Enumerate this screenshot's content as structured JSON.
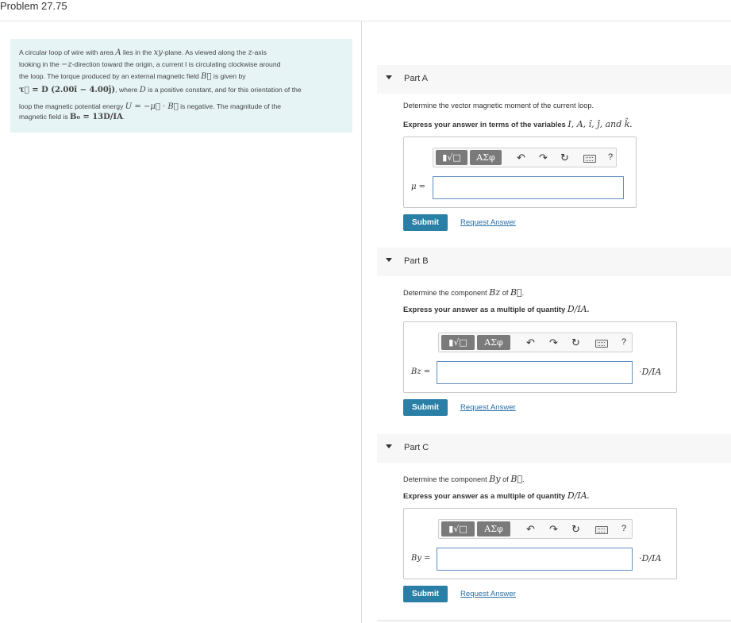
{
  "page": {
    "title": "Problem 27.75"
  },
  "problem": {
    "line1a": "A circular loop of wire with area ",
    "A": "A",
    "line1b": " lies in the ",
    "xy": "xy",
    "line1c": "-plane. As viewed along the ",
    "z": "z",
    "line1d": "-axis",
    "line2a": "looking in the ",
    "negz": "−z",
    "line2b": "-direction toward the origin, a current I is circulating clockwise around",
    "line3a": "the loop. The torque produced by an external magnetic field ",
    "B": "B⃗",
    "line3b": " is given by",
    "torque_expr": "τ⃗ = D (2.00î − 4.00ĵ)",
    "line4b": ", where ",
    "D": "D",
    "line4c": " is a positive constant, and for this orientation of the",
    "line5a": "loop the magnetic potential energy ",
    "U_expr": "U = −μ⃗ · B⃗",
    "line5b": " is negative. The magnitude of the",
    "line6a": "magnetic field is ",
    "B0_expr": "B₀ = 13D/IA",
    "line6b": "."
  },
  "toolbar": {
    "templates_label": "▮√□",
    "greek_label": "ΑΣφ",
    "undo_icon": "↶",
    "redo_icon": "↷",
    "reset_icon": "↻",
    "help_label": "?"
  },
  "partA": {
    "label": "Part A",
    "instruction": "Determine the vector magnetic moment of the current loop.",
    "express_prefix": "Express your answer in terms of the variables ",
    "express_vars": "I, A, î, ĵ, and k̂",
    "express_suffix": ".",
    "field_label": "μ =",
    "field_value": "",
    "unit": "",
    "submit_label": "Submit",
    "request_label": "Request Answer"
  },
  "partB": {
    "label": "Part B",
    "instruction_prefix": "Determine the component ",
    "instruction_var": "Bz",
    "instruction_mid": " of ",
    "instruction_vec": "B⃗",
    "instruction_suffix": ".",
    "express_prefix": "Express your answer as a multiple of quantity ",
    "express_var": "D/IA",
    "express_suffix": ".",
    "field_label": "Bz =",
    "field_value": "",
    "unit": "·D/IA",
    "submit_label": "Submit",
    "request_label": "Request Answer"
  },
  "partC": {
    "label": "Part C",
    "instruction_prefix": "Determine the component ",
    "instruction_var": "By",
    "instruction_mid": " of ",
    "instruction_vec": "B⃗",
    "instruction_suffix": ".",
    "express_prefix": "Express your answer as a multiple of quantity ",
    "express_var": "D/IA",
    "express_suffix": ".",
    "field_label": "By =",
    "field_value": "",
    "unit": "·D/IA",
    "submit_label": "Submit",
    "request_label": "Request Answer"
  },
  "colors": {
    "problem_bg": "#e6f4f5",
    "submit_bg": "#2a7fa7",
    "link": "#2a6fa7",
    "field_border": "#5f8fbf"
  }
}
